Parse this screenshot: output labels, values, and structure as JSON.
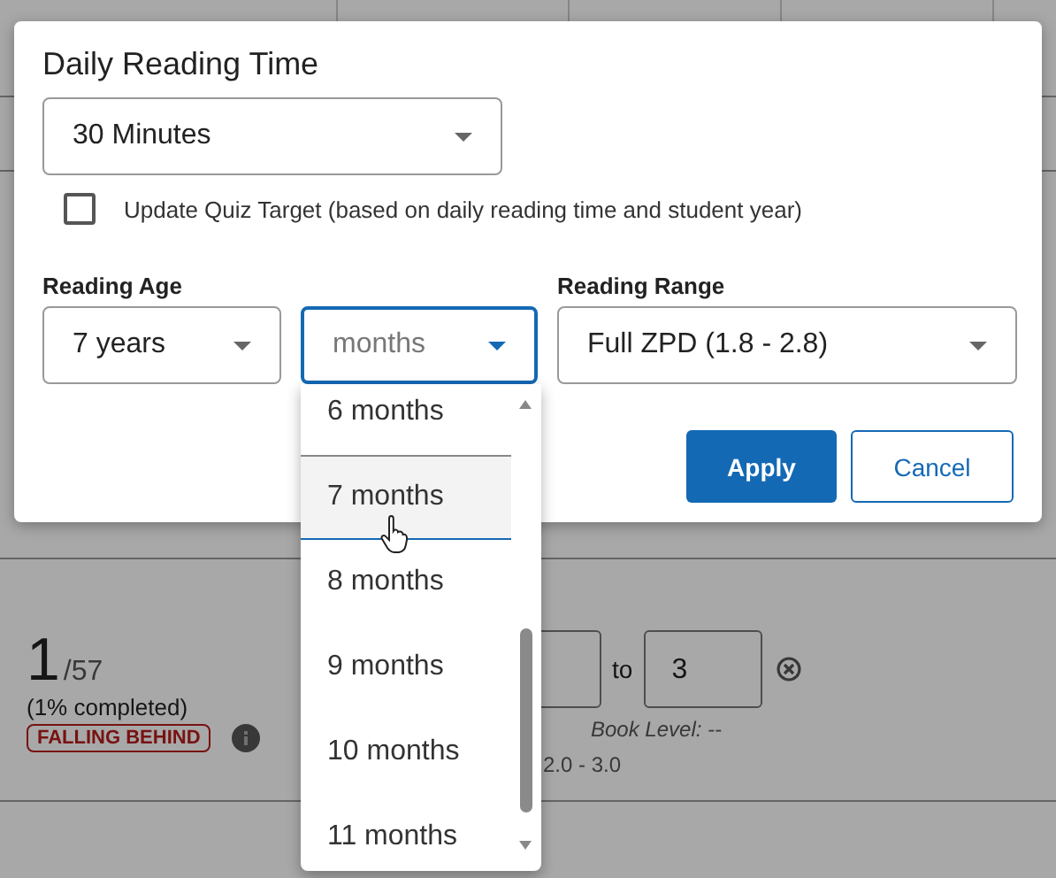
{
  "background": {
    "progress": {
      "count": "1",
      "total": "/57",
      "percent": "(1% completed)",
      "status": "FALLING BEHIND"
    },
    "level_range": {
      "to_label": "to",
      "to_value": "3",
      "book_level": "Book Level: --",
      "range": "2.0 - 3.0"
    }
  },
  "dialog": {
    "title": "Daily Reading Time",
    "time_select": "30 Minutes",
    "quiz_target": {
      "label": "Update Quiz Target (based on daily reading time and student year)",
      "checked": false
    },
    "reading_age_label": "Reading Age",
    "years_select": "7 years",
    "months_select": {
      "placeholder": "months",
      "focused": true
    },
    "reading_range_label": "Reading Range",
    "range_select": "Full ZPD (1.8 - 2.8)",
    "buttons": [
      {
        "label": "Apply",
        "kind": "primary"
      },
      {
        "label": "Cancel",
        "kind": "secondary"
      }
    ]
  },
  "months_menu": {
    "items": [
      {
        "label": "6 months",
        "hovered": false
      },
      {
        "label": "7 months",
        "hovered": true
      },
      {
        "label": "8 months",
        "hovered": false
      },
      {
        "label": "9 months",
        "hovered": false
      },
      {
        "label": "10 months",
        "hovered": false
      },
      {
        "label": "11 months",
        "hovered": false
      }
    ]
  }
}
